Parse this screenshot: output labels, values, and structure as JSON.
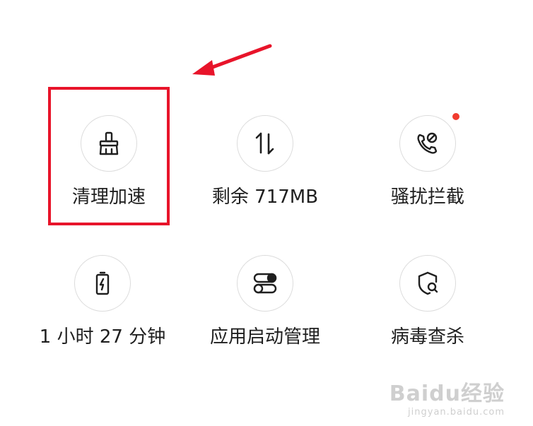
{
  "tiles": [
    {
      "label": "清理加速",
      "icon": "broom-icon"
    },
    {
      "label": "剩余 717MB",
      "icon": "up-down-arrows-icon"
    },
    {
      "label": "骚扰拦截",
      "icon": "phone-block-icon",
      "badge": true
    },
    {
      "label": "1 小时 27 分钟",
      "icon": "battery-icon"
    },
    {
      "label": "应用启动管理",
      "icon": "toggles-icon"
    },
    {
      "label": "病毒查杀",
      "icon": "shield-search-icon"
    }
  ],
  "colors": {
    "highlight": "#e8142a",
    "arrow": "#e8142a",
    "badge": "#f13b2f"
  },
  "watermark": {
    "main": "Baidu经验",
    "sub": "jingyan.baidu.com"
  }
}
